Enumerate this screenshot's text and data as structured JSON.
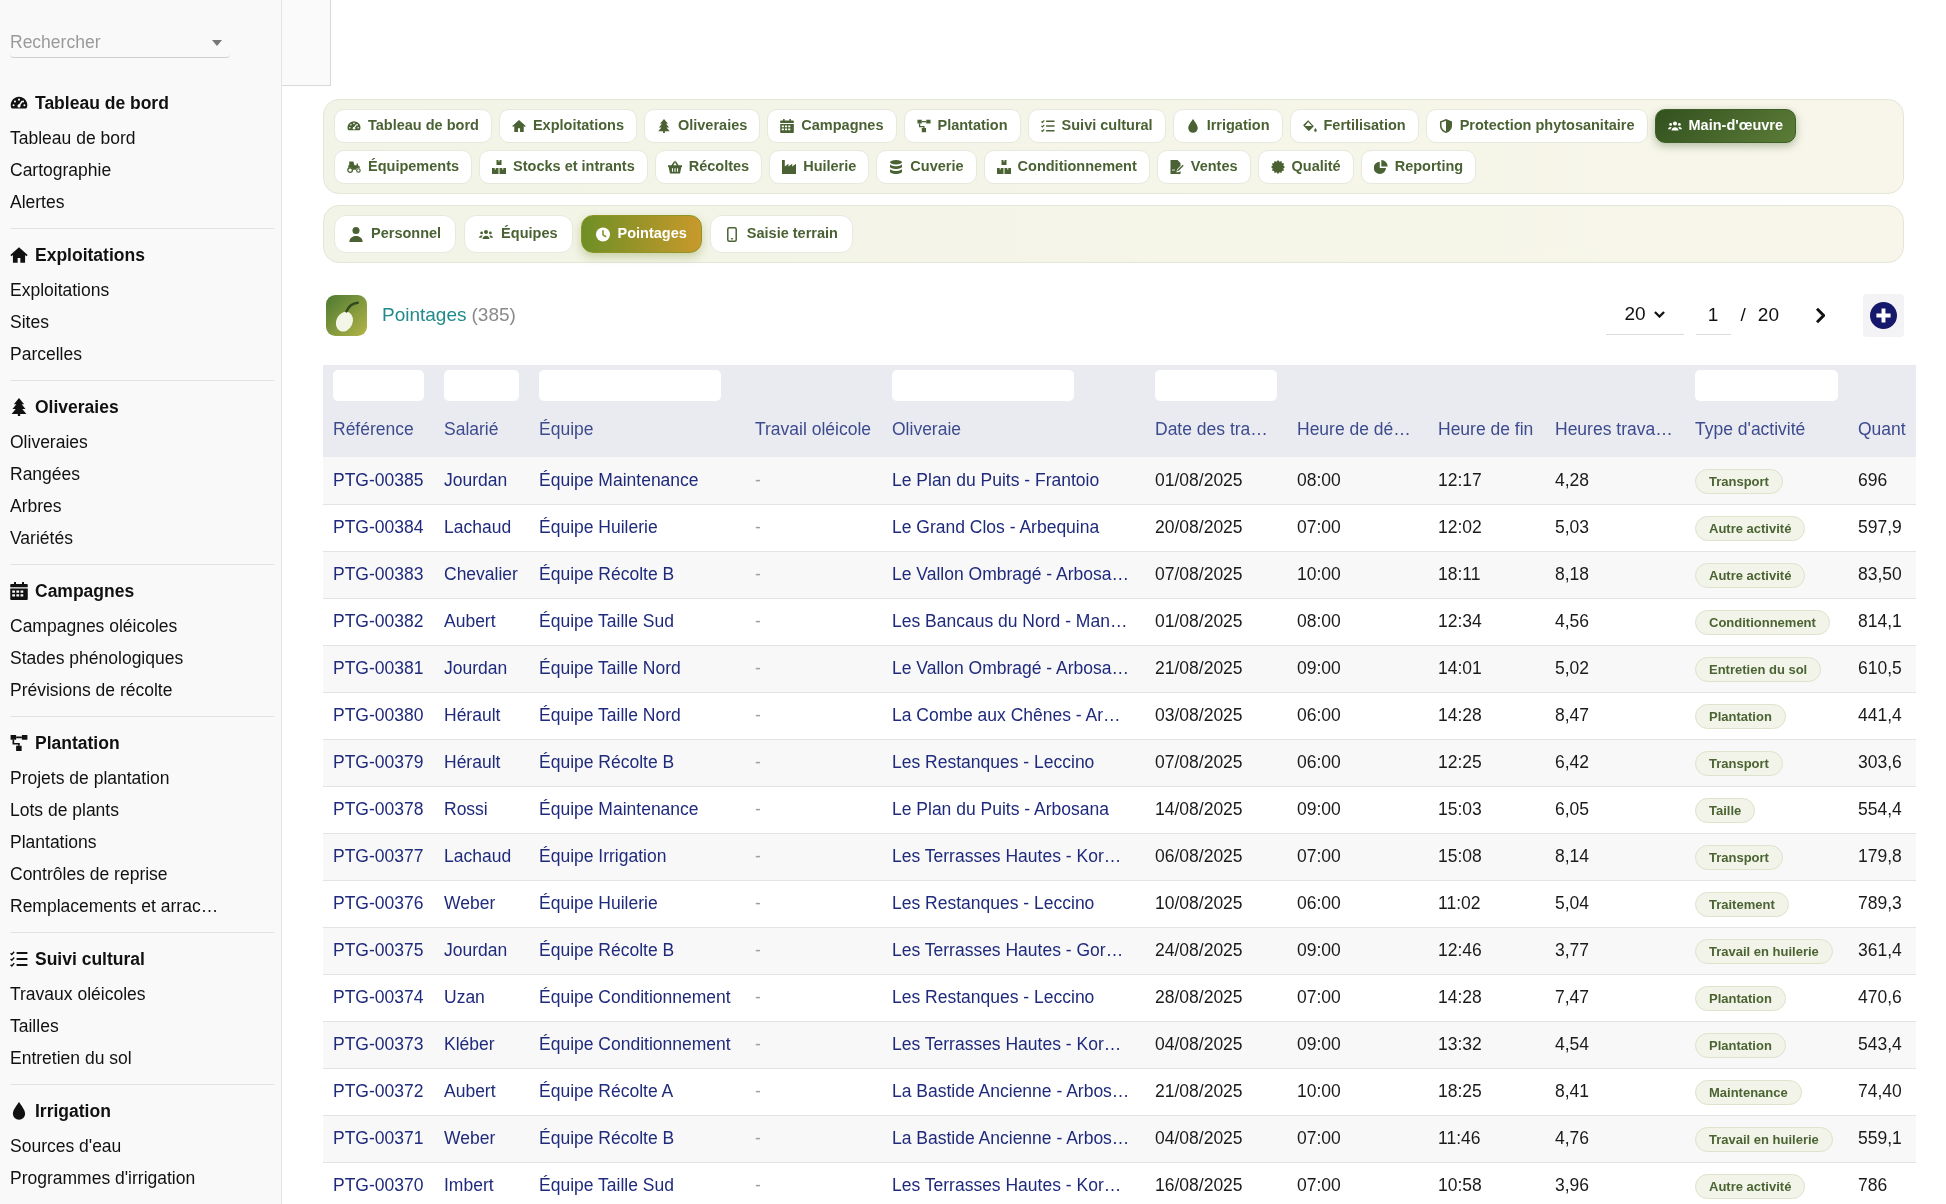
{
  "sidebar": {
    "search": {
      "placeholder": "Rechercher"
    },
    "sections": [
      {
        "title": "Tableau de bord",
        "items": [
          "Tableau de bord",
          "Cartographie",
          "Alertes"
        ]
      },
      {
        "title": "Exploitations",
        "items": [
          "Exploitations",
          "Sites",
          "Parcelles"
        ]
      },
      {
        "title": "Oliveraies",
        "items": [
          "Oliveraies",
          "Rangées",
          "Arbres",
          "Variétés"
        ]
      },
      {
        "title": "Campagnes",
        "items": [
          "Campagnes oléicoles",
          "Stades phénologiques",
          "Prévisions de récolte"
        ]
      },
      {
        "title": "Plantation",
        "items": [
          "Projets de plantation",
          "Lots de plants",
          "Plantations",
          "Contrôles de reprise",
          "Remplacements et arrac…"
        ]
      },
      {
        "title": "Suivi cultural",
        "items": [
          "Travaux oléicoles",
          "Tailles",
          "Entretien du sol"
        ]
      },
      {
        "title": "Irrigation",
        "items": [
          "Sources d'eau",
          "Programmes d'irrigation"
        ]
      }
    ]
  },
  "module_tabs": [
    {
      "label": "Tableau de bord",
      "selected": false
    },
    {
      "label": "Exploitations",
      "selected": false
    },
    {
      "label": "Oliveraies",
      "selected": false
    },
    {
      "label": "Campagnes",
      "selected": false
    },
    {
      "label": "Plantation",
      "selected": false
    },
    {
      "label": "Suivi cultural",
      "selected": false
    },
    {
      "label": "Irrigation",
      "selected": false
    },
    {
      "label": "Fertilisation",
      "selected": false
    },
    {
      "label": "Protection phytosanitaire",
      "selected": false
    },
    {
      "label": "Main-d'œuvre",
      "selected": true
    },
    {
      "label": "Équipements",
      "selected": false
    },
    {
      "label": "Stocks et intrants",
      "selected": false
    },
    {
      "label": "Récoltes",
      "selected": false
    },
    {
      "label": "Huilerie",
      "selected": false
    },
    {
      "label": "Cuverie",
      "selected": false
    },
    {
      "label": "Conditionnement",
      "selected": false
    },
    {
      "label": "Ventes",
      "selected": false
    },
    {
      "label": "Qualité",
      "selected": false
    },
    {
      "label": "Reporting",
      "selected": false
    }
  ],
  "sub_tabs": [
    {
      "label": "Personnel",
      "selected": false
    },
    {
      "label": "Équipes",
      "selected": false
    },
    {
      "label": "Pointages",
      "selected": true
    },
    {
      "label": "Saisie terrain",
      "selected": false
    }
  ],
  "page_header": {
    "title": "Pointages",
    "count": "(385)"
  },
  "pagination": {
    "page_size": "20",
    "page": "1",
    "separator": "/",
    "pages": "20"
  },
  "table": {
    "columns": [
      {
        "label": "Référence",
        "kind": "link",
        "filter": true
      },
      {
        "label": "Salarié",
        "kind": "link",
        "filter": true
      },
      {
        "label": "Équipe",
        "kind": "link",
        "filter": true
      },
      {
        "label": "Travail oléicole",
        "kind": "muted",
        "filter": false
      },
      {
        "label": "Oliveraie",
        "kind": "link",
        "filter": true
      },
      {
        "label": "Date des tra…",
        "kind": "text",
        "filter": true
      },
      {
        "label": "Heure de dé…",
        "kind": "text",
        "filter": false
      },
      {
        "label": "Heure de fin",
        "kind": "text",
        "filter": false
      },
      {
        "label": "Heures trava…",
        "kind": "text",
        "filter": false
      },
      {
        "label": "Type d'activité",
        "kind": "badge",
        "filter": true
      },
      {
        "label": "Quant",
        "kind": "text",
        "filter": false
      }
    ],
    "rows": [
      [
        "PTG-00385",
        "Jourdan",
        "Équipe Maintenance",
        "-",
        "Le Plan du Puits - Frantoio",
        "01/08/2025",
        "08:00",
        "12:17",
        "4,28",
        "Transport",
        "696"
      ],
      [
        "PTG-00384",
        "Lachaud",
        "Équipe Huilerie",
        "-",
        "Le Grand Clos - Arbequina",
        "20/08/2025",
        "07:00",
        "12:02",
        "5,03",
        "Autre activité",
        "597,9"
      ],
      [
        "PTG-00383",
        "Chevalier",
        "Équipe Récolte B",
        "-",
        "Le Vallon Ombragé - Arbosa…",
        "07/08/2025",
        "10:00",
        "18:11",
        "8,18",
        "Autre activité",
        "83,50"
      ],
      [
        "PTG-00382",
        "Aubert",
        "Équipe Taille Sud",
        "-",
        "Les Bancaus du Nord - Man…",
        "01/08/2025",
        "08:00",
        "12:34",
        "4,56",
        "Conditionnement",
        "814,1"
      ],
      [
        "PTG-00381",
        "Jourdan",
        "Équipe Taille Nord",
        "-",
        "Le Vallon Ombragé - Arbosa…",
        "21/08/2025",
        "09:00",
        "14:01",
        "5,02",
        "Entretien du sol",
        "610,5"
      ],
      [
        "PTG-00380",
        "Hérault",
        "Équipe Taille Nord",
        "-",
        "La Combe aux Chênes - Ar…",
        "03/08/2025",
        "06:00",
        "14:28",
        "8,47",
        "Plantation",
        "441,4"
      ],
      [
        "PTG-00379",
        "Hérault",
        "Équipe Récolte B",
        "-",
        "Les Restanques - Leccino",
        "07/08/2025",
        "06:00",
        "12:25",
        "6,42",
        "Transport",
        "303,6"
      ],
      [
        "PTG-00378",
        "Rossi",
        "Équipe Maintenance",
        "-",
        "Le Plan du Puits - Arbosana",
        "14/08/2025",
        "09:00",
        "15:03",
        "6,05",
        "Taille",
        "554,4"
      ],
      [
        "PTG-00377",
        "Lachaud",
        "Équipe Irrigation",
        "-",
        "Les Terrasses Hautes - Kor…",
        "06/08/2025",
        "07:00",
        "15:08",
        "8,14",
        "Transport",
        "179,8"
      ],
      [
        "PTG-00376",
        "Weber",
        "Équipe Huilerie",
        "-",
        "Les Restanques - Leccino",
        "10/08/2025",
        "06:00",
        "11:02",
        "5,04",
        "Traitement",
        "789,3"
      ],
      [
        "PTG-00375",
        "Jourdan",
        "Équipe Récolte B",
        "-",
        "Les Terrasses Hautes - Gor…",
        "24/08/2025",
        "09:00",
        "12:46",
        "3,77",
        "Travail en huilerie",
        "361,4"
      ],
      [
        "PTG-00374",
        "Uzan",
        "Équipe Conditionnement",
        "-",
        "Les Restanques - Leccino",
        "28/08/2025",
        "07:00",
        "14:28",
        "7,47",
        "Plantation",
        "470,6"
      ],
      [
        "PTG-00373",
        "Kléber",
        "Équipe Conditionnement",
        "-",
        "Les Terrasses Hautes - Kor…",
        "04/08/2025",
        "09:00",
        "13:32",
        "4,54",
        "Plantation",
        "543,4"
      ],
      [
        "PTG-00372",
        "Aubert",
        "Équipe Récolte A",
        "-",
        "La Bastide Ancienne - Arbos…",
        "21/08/2025",
        "10:00",
        "18:25",
        "8,41",
        "Maintenance",
        "74,40"
      ],
      [
        "PTG-00371",
        "Weber",
        "Équipe Récolte B",
        "-",
        "La Bastide Ancienne - Arbos…",
        "04/08/2025",
        "07:00",
        "11:46",
        "4,76",
        "Travail en huilerie",
        "559,1"
      ],
      [
        "PTG-00370",
        "Imbert",
        "Équipe Taille Sud",
        "-",
        "Les Terrasses Hautes - Kor…",
        "16/08/2025",
        "07:00",
        "10:58",
        "3,96",
        "Autre activité",
        "786"
      ]
    ]
  }
}
